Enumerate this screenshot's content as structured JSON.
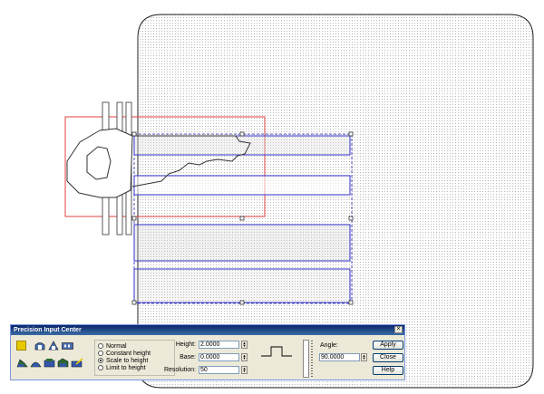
{
  "panel": {
    "title": "Precision Input Center",
    "close": "×",
    "modes": [
      {
        "label": "Normal",
        "selected": false
      },
      {
        "label": "Constant height",
        "selected": false
      },
      {
        "label": "Scale to height",
        "selected": true
      },
      {
        "label": "Limit to height",
        "selected": false
      }
    ],
    "height_label": "Height:",
    "height_value": "2.0000",
    "base_label": "Base:",
    "base_value": "0.0000",
    "resolution_label": "Resolution:",
    "resolution_value": "50",
    "angle_label": "Angle:",
    "angle_value": "90.0000",
    "apply_label": "Apply",
    "close_label": "Close",
    "help_label": "Help"
  },
  "colors": {
    "selection_blue": "#3333cc",
    "bounds_red": "#e04040",
    "accent_yellow": "#e8c800"
  }
}
